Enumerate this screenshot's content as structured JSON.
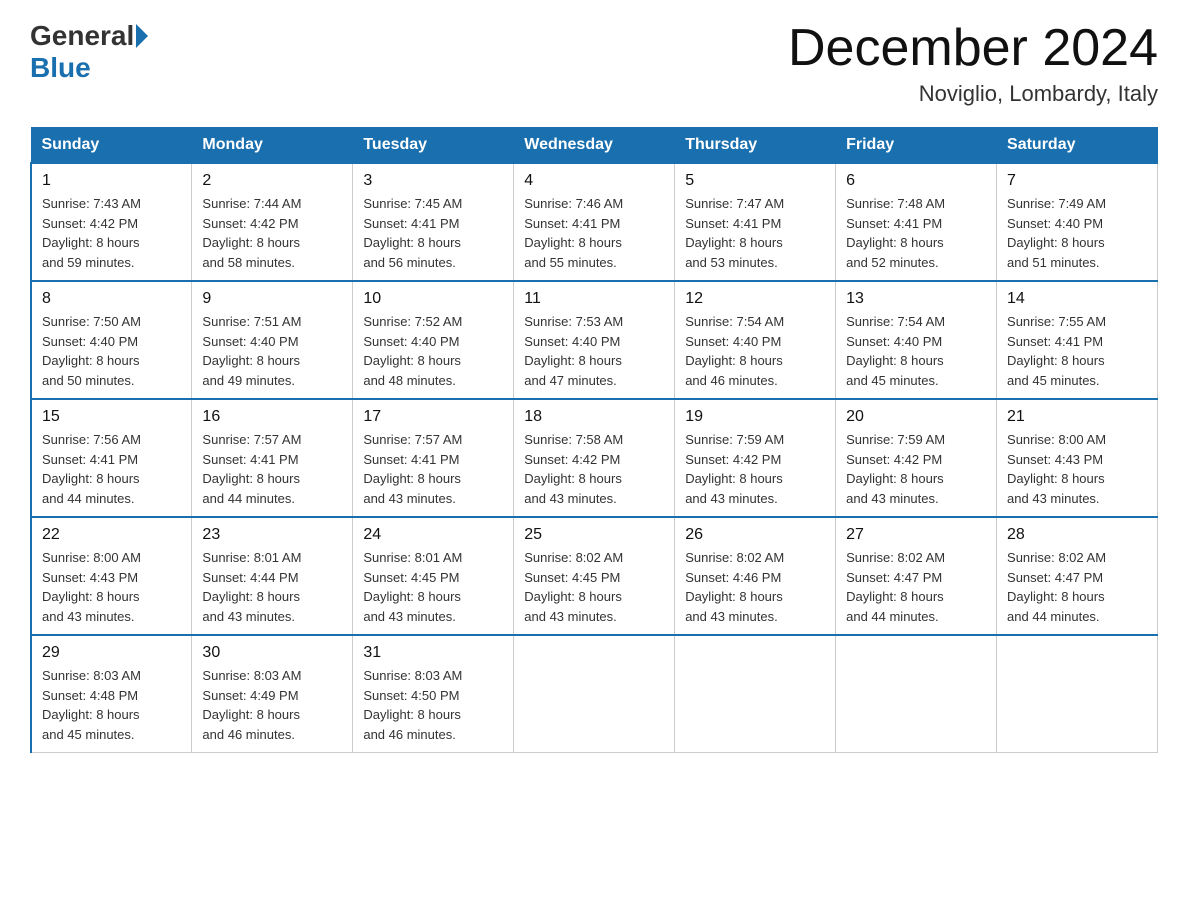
{
  "header": {
    "logo_general": "General",
    "logo_blue": "Blue",
    "month_title": "December 2024",
    "location": "Noviglio, Lombardy, Italy"
  },
  "days_of_week": [
    "Sunday",
    "Monday",
    "Tuesday",
    "Wednesday",
    "Thursday",
    "Friday",
    "Saturday"
  ],
  "weeks": [
    [
      {
        "day": 1,
        "sunrise": "7:43 AM",
        "sunset": "4:42 PM",
        "daylight": "8 hours and 59 minutes."
      },
      {
        "day": 2,
        "sunrise": "7:44 AM",
        "sunset": "4:42 PM",
        "daylight": "8 hours and 58 minutes."
      },
      {
        "day": 3,
        "sunrise": "7:45 AM",
        "sunset": "4:41 PM",
        "daylight": "8 hours and 56 minutes."
      },
      {
        "day": 4,
        "sunrise": "7:46 AM",
        "sunset": "4:41 PM",
        "daylight": "8 hours and 55 minutes."
      },
      {
        "day": 5,
        "sunrise": "7:47 AM",
        "sunset": "4:41 PM",
        "daylight": "8 hours and 53 minutes."
      },
      {
        "day": 6,
        "sunrise": "7:48 AM",
        "sunset": "4:41 PM",
        "daylight": "8 hours and 52 minutes."
      },
      {
        "day": 7,
        "sunrise": "7:49 AM",
        "sunset": "4:40 PM",
        "daylight": "8 hours and 51 minutes."
      }
    ],
    [
      {
        "day": 8,
        "sunrise": "7:50 AM",
        "sunset": "4:40 PM",
        "daylight": "8 hours and 50 minutes."
      },
      {
        "day": 9,
        "sunrise": "7:51 AM",
        "sunset": "4:40 PM",
        "daylight": "8 hours and 49 minutes."
      },
      {
        "day": 10,
        "sunrise": "7:52 AM",
        "sunset": "4:40 PM",
        "daylight": "8 hours and 48 minutes."
      },
      {
        "day": 11,
        "sunrise": "7:53 AM",
        "sunset": "4:40 PM",
        "daylight": "8 hours and 47 minutes."
      },
      {
        "day": 12,
        "sunrise": "7:54 AM",
        "sunset": "4:40 PM",
        "daylight": "8 hours and 46 minutes."
      },
      {
        "day": 13,
        "sunrise": "7:54 AM",
        "sunset": "4:40 PM",
        "daylight": "8 hours and 45 minutes."
      },
      {
        "day": 14,
        "sunrise": "7:55 AM",
        "sunset": "4:41 PM",
        "daylight": "8 hours and 45 minutes."
      }
    ],
    [
      {
        "day": 15,
        "sunrise": "7:56 AM",
        "sunset": "4:41 PM",
        "daylight": "8 hours and 44 minutes."
      },
      {
        "day": 16,
        "sunrise": "7:57 AM",
        "sunset": "4:41 PM",
        "daylight": "8 hours and 44 minutes."
      },
      {
        "day": 17,
        "sunrise": "7:57 AM",
        "sunset": "4:41 PM",
        "daylight": "8 hours and 43 minutes."
      },
      {
        "day": 18,
        "sunrise": "7:58 AM",
        "sunset": "4:42 PM",
        "daylight": "8 hours and 43 minutes."
      },
      {
        "day": 19,
        "sunrise": "7:59 AM",
        "sunset": "4:42 PM",
        "daylight": "8 hours and 43 minutes."
      },
      {
        "day": 20,
        "sunrise": "7:59 AM",
        "sunset": "4:42 PM",
        "daylight": "8 hours and 43 minutes."
      },
      {
        "day": 21,
        "sunrise": "8:00 AM",
        "sunset": "4:43 PM",
        "daylight": "8 hours and 43 minutes."
      }
    ],
    [
      {
        "day": 22,
        "sunrise": "8:00 AM",
        "sunset": "4:43 PM",
        "daylight": "8 hours and 43 minutes."
      },
      {
        "day": 23,
        "sunrise": "8:01 AM",
        "sunset": "4:44 PM",
        "daylight": "8 hours and 43 minutes."
      },
      {
        "day": 24,
        "sunrise": "8:01 AM",
        "sunset": "4:45 PM",
        "daylight": "8 hours and 43 minutes."
      },
      {
        "day": 25,
        "sunrise": "8:02 AM",
        "sunset": "4:45 PM",
        "daylight": "8 hours and 43 minutes."
      },
      {
        "day": 26,
        "sunrise": "8:02 AM",
        "sunset": "4:46 PM",
        "daylight": "8 hours and 43 minutes."
      },
      {
        "day": 27,
        "sunrise": "8:02 AM",
        "sunset": "4:47 PM",
        "daylight": "8 hours and 44 minutes."
      },
      {
        "day": 28,
        "sunrise": "8:02 AM",
        "sunset": "4:47 PM",
        "daylight": "8 hours and 44 minutes."
      }
    ],
    [
      {
        "day": 29,
        "sunrise": "8:03 AM",
        "sunset": "4:48 PM",
        "daylight": "8 hours and 45 minutes."
      },
      {
        "day": 30,
        "sunrise": "8:03 AM",
        "sunset": "4:49 PM",
        "daylight": "8 hours and 46 minutes."
      },
      {
        "day": 31,
        "sunrise": "8:03 AM",
        "sunset": "4:50 PM",
        "daylight": "8 hours and 46 minutes."
      },
      null,
      null,
      null,
      null
    ]
  ],
  "labels": {
    "sunrise": "Sunrise:",
    "sunset": "Sunset:",
    "daylight": "Daylight:"
  }
}
